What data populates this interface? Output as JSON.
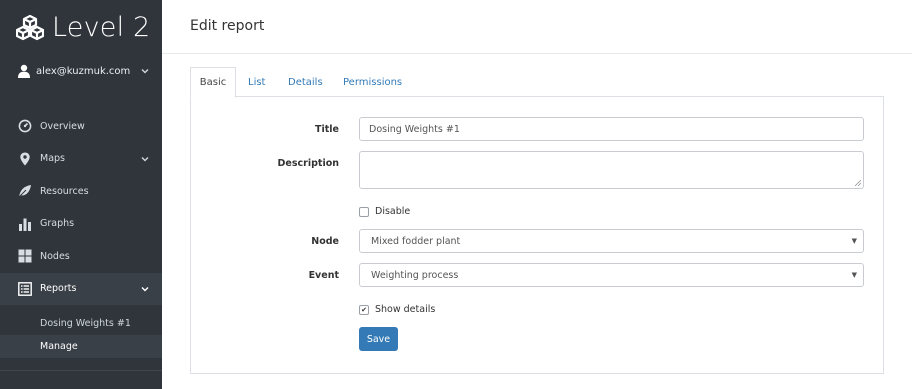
{
  "brand": {
    "name": "Level 2"
  },
  "user": {
    "email": "alex@kuzmuk.com"
  },
  "sidebar": {
    "items": [
      {
        "label": "Overview",
        "icon": "dashboard-icon"
      },
      {
        "label": "Maps",
        "icon": "map-marker-icon"
      },
      {
        "label": "Resources",
        "icon": "leaf-icon"
      },
      {
        "label": "Graphs",
        "icon": "bar-chart-icon"
      },
      {
        "label": "Nodes",
        "icon": "grid-icon"
      },
      {
        "label": "Reports",
        "icon": "list-icon"
      }
    ],
    "subitems": [
      {
        "label": "Dosing Weights #1"
      },
      {
        "label": "Manage"
      }
    ]
  },
  "page": {
    "title": "Edit report"
  },
  "tabs": [
    {
      "label": "Basic"
    },
    {
      "label": "List"
    },
    {
      "label": "Details"
    },
    {
      "label": "Permissions"
    }
  ],
  "form": {
    "title_label": "Title",
    "title_value": "Dosing Weights #1",
    "description_label": "Description",
    "description_value": "",
    "disable_label": "Disable",
    "disable_checked": false,
    "node_label": "Node",
    "node_value": "Mixed fodder plant",
    "event_label": "Event",
    "event_value": "Weighting process",
    "show_details_label": "Show details",
    "show_details_checked": true,
    "save_label": "Save",
    "check_mark": "✔"
  },
  "colors": {
    "sidebar_bg": "#2f353b",
    "accent": "#337ab7"
  }
}
